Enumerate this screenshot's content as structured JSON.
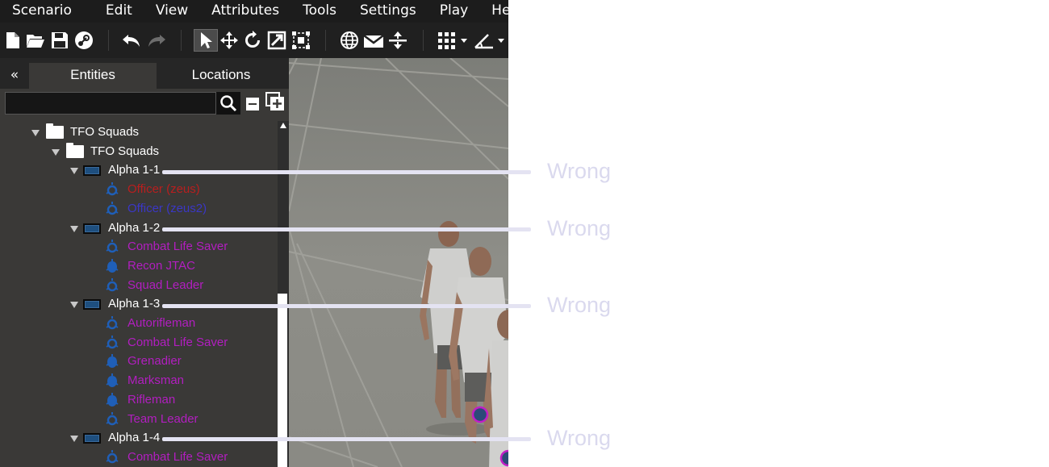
{
  "menu": [
    "Scenario",
    "Edit",
    "View",
    "Attributes",
    "Tools",
    "Settings",
    "Play",
    "Help"
  ],
  "panel": {
    "collapse_label": "«",
    "tabs": [
      "Entities",
      "Locations"
    ],
    "search": {
      "value": "",
      "placeholder": ""
    }
  },
  "tree": {
    "root_folder": "TFO Squads",
    "sub_folder": "TFO Squads",
    "groups": [
      {
        "name": "Alpha 1-1",
        "units": [
          {
            "name": "Officer (zeus)",
            "color": "#b91e1e",
            "icon": "unit-ring-icon"
          },
          {
            "name": "Officer (zeus2)",
            "color": "#3a37c6",
            "icon": "unit-ring-icon"
          }
        ]
      },
      {
        "name": "Alpha 1-2",
        "units": [
          {
            "name": "Combat Life Saver",
            "color": "#b21ec0",
            "icon": "unit-ring-icon"
          },
          {
            "name": "Recon JTAC",
            "color": "#b21ec0",
            "icon": "unit-solid-icon"
          },
          {
            "name": "Squad Leader",
            "color": "#b21ec0",
            "icon": "unit-ring-icon"
          }
        ]
      },
      {
        "name": "Alpha 1-3",
        "units": [
          {
            "name": "Autorifleman",
            "color": "#b21ec0",
            "icon": "unit-ring-icon"
          },
          {
            "name": "Combat Life Saver",
            "color": "#b21ec0",
            "icon": "unit-ring-icon"
          },
          {
            "name": "Grenadier",
            "color": "#b21ec0",
            "icon": "unit-solid-icon"
          },
          {
            "name": "Marksman",
            "color": "#b21ec0",
            "icon": "unit-solid-icon"
          },
          {
            "name": "Rifleman",
            "color": "#b21ec0",
            "icon": "unit-solid-icon"
          },
          {
            "name": "Team Leader",
            "color": "#b21ec0",
            "icon": "unit-ring-icon"
          }
        ]
      },
      {
        "name": "Alpha 1-4",
        "units": [
          {
            "name": "Combat Life Saver",
            "color": "#b21ec0",
            "icon": "unit-ring-icon"
          }
        ]
      }
    ]
  },
  "annotations": [
    "Wrong",
    "Wrong",
    "Wrong",
    "Wrong"
  ],
  "colors": {
    "menubar": "#1c1c1c",
    "panel": "#3a3937",
    "unit_side": "#b21ec0",
    "group_icon": "#1e4f7f",
    "annotation": "#dad9ee"
  }
}
